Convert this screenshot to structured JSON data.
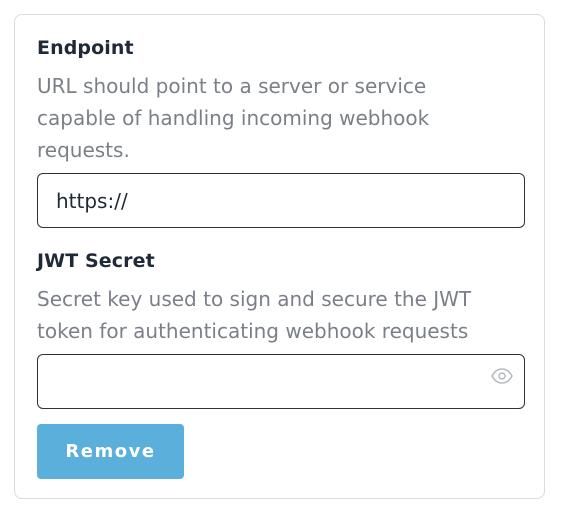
{
  "endpoint": {
    "label": "Endpoint",
    "description": "URL should point to a server or service capable of handling incoming webhook requests.",
    "value": "https://"
  },
  "jwt_secret": {
    "label": "JWT Secret",
    "description": "Secret key used to sign and secure the JWT token for authenticating webhook requests",
    "value": "",
    "toggle_icon": "eye-icon"
  },
  "actions": {
    "remove_label": "Remove"
  },
  "colors": {
    "button": "#5aafdb",
    "label": "#1f2937",
    "description": "#7b8088",
    "border": "#d9dbe0"
  }
}
